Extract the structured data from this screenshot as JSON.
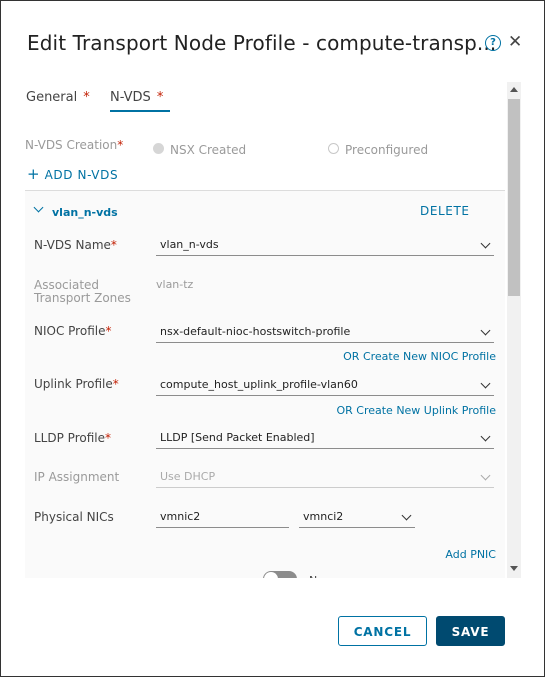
{
  "dialog": {
    "title": "Edit Transport Node Profile - compute-transp...",
    "help_icon": "?",
    "close_icon": "✕"
  },
  "tabs": [
    {
      "label": "General",
      "required": "*"
    },
    {
      "label": "N-VDS",
      "required": "*"
    }
  ],
  "nvds": {
    "creation_label": "N-VDS Creation",
    "required": "*",
    "option_nsx": "NSX Created",
    "option_pre": "Preconfigured",
    "add_nvds": "ADD N-VDS",
    "add_icon": "+"
  },
  "panel": {
    "name": "vlan_n-vds",
    "delete": "DELETE",
    "nvds_name_label": "N-VDS Name",
    "nvds_name_value": "vlan_n-vds",
    "assoc_zones_label1": "Associated",
    "assoc_zones_label2": "Transport Zones",
    "assoc_zones_value": "vlan-tz",
    "nioc_label": "NIOC Profile",
    "nioc_value": "nsx-default-nioc-hostswitch-profile",
    "nioc_link": "OR Create New NIOC Profile",
    "uplink_label": "Uplink Profile",
    "uplink_value": "compute_host_uplink_profile-vlan60",
    "uplink_link": "OR Create New Uplink Profile",
    "lldp_label": "LLDP Profile",
    "lldp_value": "LLDP [Send Packet Enabled]",
    "ip_label": "IP Assignment",
    "ip_value": "Use DHCP",
    "pnic_label": "Physical NICs",
    "pnic_value": "vmnic2",
    "pnic_uplink_value": "vmnci2",
    "add_pnic": "Add PNIC",
    "toggle_label": "N"
  },
  "footer": {
    "cancel": "CANCEL",
    "save": "SAVE"
  },
  "colors": {
    "accent": "#0072a3",
    "primary_button": "#004a70",
    "required": "#c21d00"
  }
}
